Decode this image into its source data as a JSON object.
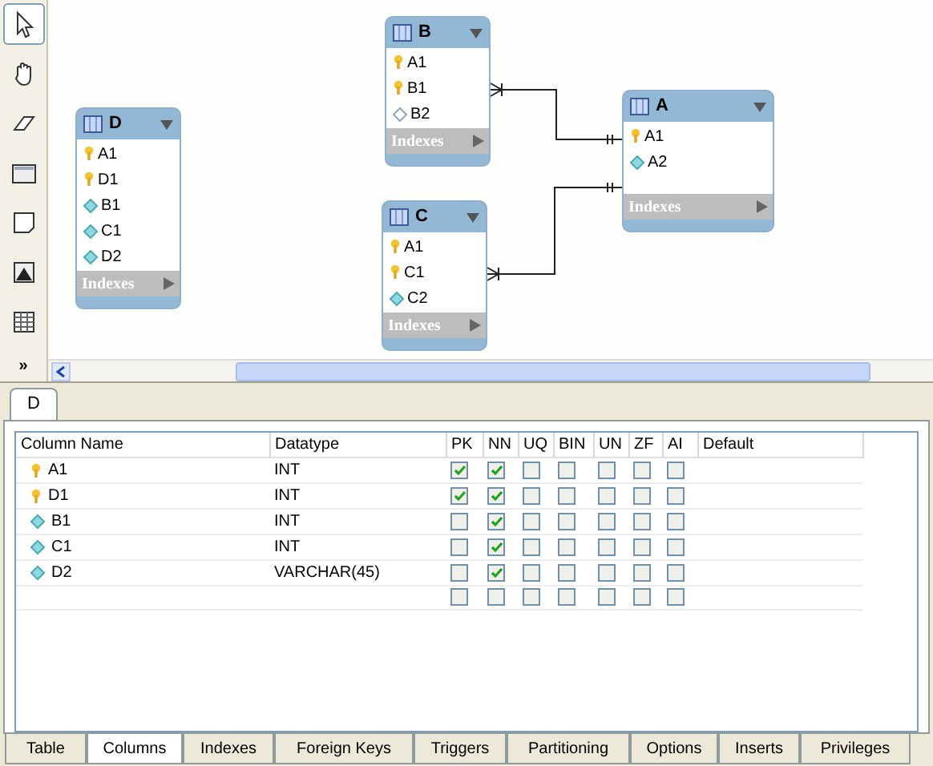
{
  "toolbar": {
    "tools": [
      {
        "selected": true
      },
      {
        "selected": false
      },
      {
        "selected": false
      },
      {
        "selected": false
      },
      {
        "selected": false
      },
      {
        "selected": false
      },
      {
        "selected": false
      }
    ],
    "more": "»"
  },
  "diagram": {
    "tables": [
      {
        "name": "D",
        "columns": [
          {
            "name": "A1",
            "kind": "key"
          },
          {
            "name": "D1",
            "kind": "key"
          },
          {
            "name": "B1",
            "kind": "column"
          },
          {
            "name": "C1",
            "kind": "column"
          },
          {
            "name": "D2",
            "kind": "column"
          }
        ],
        "indexes": "Indexes"
      },
      {
        "name": "B",
        "columns": [
          {
            "name": "A1",
            "kind": "key"
          },
          {
            "name": "B1",
            "kind": "key"
          },
          {
            "name": "B2",
            "kind": "nullable"
          }
        ],
        "indexes": "Indexes"
      },
      {
        "name": "C",
        "columns": [
          {
            "name": "A1",
            "kind": "key"
          },
          {
            "name": "C1",
            "kind": "key"
          },
          {
            "name": "C2",
            "kind": "column"
          }
        ],
        "indexes": "Indexes"
      },
      {
        "name": "A",
        "columns": [
          {
            "name": "A1",
            "kind": "key"
          },
          {
            "name": "A2",
            "kind": "column"
          }
        ],
        "indexes": "Indexes"
      }
    ]
  },
  "editor_tab": "D",
  "grid": {
    "columns": [
      "Column Name",
      "Datatype",
      "PK",
      "NN",
      "UQ",
      "BIN",
      "UN",
      "ZF",
      "AI",
      "Default"
    ],
    "rows": [
      {
        "name": "A1",
        "kind": "key",
        "datatype": "INT",
        "flags": [
          true,
          true,
          false,
          false,
          false,
          false,
          false
        ]
      },
      {
        "name": "D1",
        "kind": "key",
        "datatype": "INT",
        "flags": [
          true,
          true,
          false,
          false,
          false,
          false,
          false
        ]
      },
      {
        "name": "B1",
        "kind": "column",
        "datatype": "INT",
        "flags": [
          false,
          true,
          false,
          false,
          false,
          false,
          false
        ]
      },
      {
        "name": "C1",
        "kind": "column",
        "datatype": "INT",
        "flags": [
          false,
          true,
          false,
          false,
          false,
          false,
          false
        ]
      },
      {
        "name": "D2",
        "kind": "column",
        "datatype": "VARCHAR(45)",
        "flags": [
          false,
          true,
          false,
          false,
          false,
          false,
          false
        ]
      },
      {
        "flags": [
          false,
          false,
          false,
          false,
          false,
          false,
          false
        ]
      }
    ]
  },
  "bottom_tabs": [
    {
      "label": "Table",
      "selected": false
    },
    {
      "label": "Columns",
      "selected": true
    },
    {
      "label": "Indexes",
      "selected": false
    },
    {
      "label": "Foreign Keys",
      "selected": false
    },
    {
      "label": "Triggers",
      "selected": false
    },
    {
      "label": "Partitioning",
      "selected": false
    },
    {
      "label": "Options",
      "selected": false
    },
    {
      "label": "Inserts",
      "selected": false
    },
    {
      "label": "Privileges",
      "selected": false
    }
  ]
}
